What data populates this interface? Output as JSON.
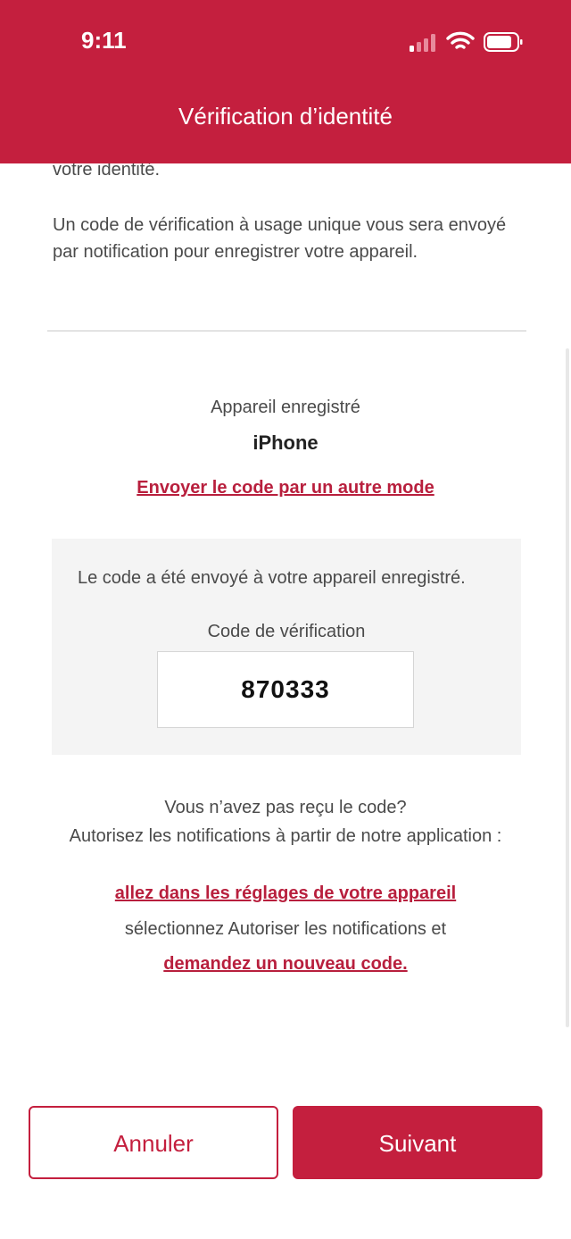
{
  "status_bar": {
    "time": "9:11"
  },
  "header": {
    "title": "Vérification d’identité"
  },
  "intro": {
    "partial_line": "votre identité.",
    "paragraph": "Un code de vérification à usage unique vous sera envoyé par notification pour enregistrer votre appareil."
  },
  "device": {
    "label": "Appareil enregistré",
    "name": "iPhone",
    "other_mode_link": "Envoyer le code par un autre mode"
  },
  "code_panel": {
    "message": "Le code a été envoyé à votre appareil enregistré.",
    "label": "Code de vérification",
    "value": "870333"
  },
  "help": {
    "line1": "Vous n’avez pas reçu le code?",
    "line2": "Autorisez les notifications à partir de notre application :",
    "settings_link": "allez dans les réglages de votre appareil",
    "line3": "sélectionnez Autoriser les notifications et",
    "new_code_link": "demandez un nouveau code."
  },
  "buttons": {
    "cancel": "Annuler",
    "next": "Suivant"
  },
  "colors": {
    "brand": "#c41f3e",
    "link": "#b81f3d",
    "panel_bg": "#f4f4f4"
  },
  "icons": [
    "cellular-signal-icon",
    "wifi-icon",
    "battery-icon"
  ]
}
